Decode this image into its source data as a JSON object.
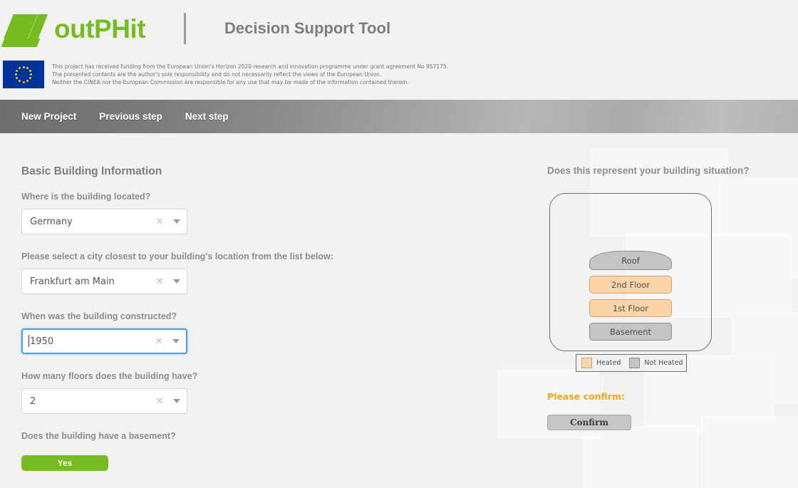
{
  "brand": {
    "logo_word": "outPHit",
    "logo_mark_icon": "outphit-arrow-logo-icon",
    "app_title": "Decision Support Tool",
    "accent_green": "#76bc21"
  },
  "eu_funding": {
    "flag_icon": "european-union-flag-icon",
    "line1": "This project has received funding from the European Union's Horizon 2020 research and innovation programme under grant agreement No 957175.",
    "line2": "The presented contents are the author's sole responsibility and do not necessarily reflect the views of the European Union.",
    "line3": "Neither the CINEA nor the European Commission are responsible for any use that may be made of the information contained therein."
  },
  "navbar": {
    "items": [
      {
        "label": "New Project"
      },
      {
        "label": "Previous step"
      },
      {
        "label": "Next step"
      }
    ]
  },
  "form": {
    "section_title": "Basic Building Information",
    "fields": [
      {
        "label": "Where is the building located?",
        "value": "Germany",
        "clear_icon": "close-x-icon",
        "caret_icon": "chevron-down-icon"
      },
      {
        "label": "Please select a city closest to your building's location from the list below:",
        "value": "Frankfurt am Main",
        "clear_icon": "close-x-icon",
        "caret_icon": "chevron-down-icon"
      },
      {
        "label": "When was the building constructed?",
        "value": "1950",
        "clear_icon": "close-x-icon",
        "caret_icon": "chevron-down-icon"
      },
      {
        "label": "How many floors does the building have?",
        "value": "2",
        "clear_icon": "close-x-icon",
        "caret_icon": "chevron-down-icon"
      }
    ],
    "basement_label": "Does the building have a basement?",
    "basement_answer": "Yes"
  },
  "building_panel": {
    "title": "Does this represent your building situation?",
    "floors": [
      {
        "name": "Roof",
        "state": "Not Heated"
      },
      {
        "name": "2nd Floor",
        "state": "Heated"
      },
      {
        "name": "1st Floor",
        "state": "Heated"
      },
      {
        "name": "Basement",
        "state": "Not Heated"
      }
    ],
    "legend": {
      "heated_label": "Heated",
      "not_heated_label": "Not Heated",
      "heated_color": "#fbd5a5",
      "not_heated_color": "#c4c4c4"
    },
    "confirm_prompt": "Please confirm:",
    "confirm_button": "Confirm",
    "confirm_prompt_color": "#f2a413"
  }
}
